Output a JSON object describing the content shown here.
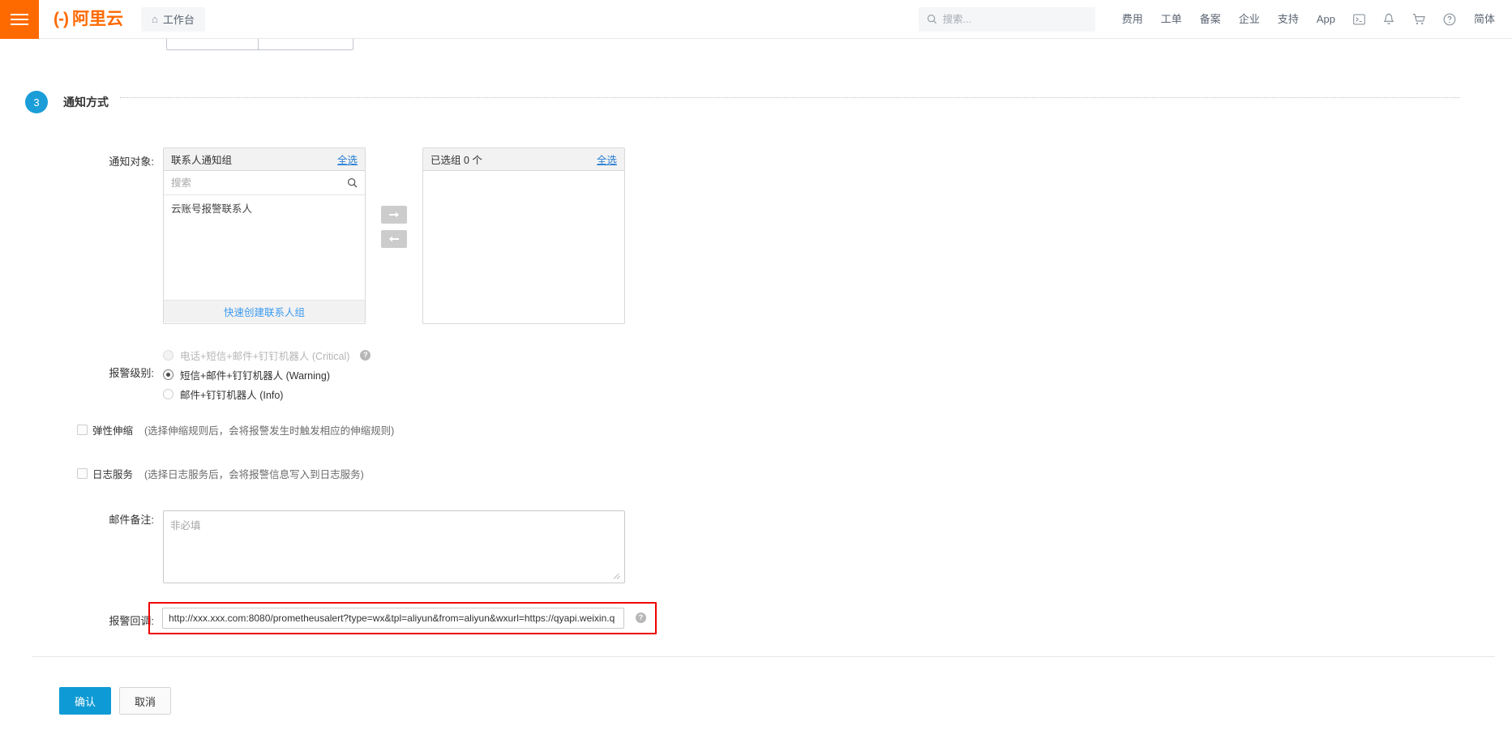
{
  "header": {
    "menu_icon": "hamburger-icon",
    "brand_mark": "(-)",
    "brand_name": "阿里云",
    "workbench_icon": "home-icon",
    "workbench_label": "工作台",
    "search": {
      "placeholder": "搜索...",
      "value": "",
      "icon": "search-icon"
    },
    "nav_links": [
      {
        "label": "费用"
      },
      {
        "label": "工单"
      },
      {
        "label": "备案"
      },
      {
        "label": "企业"
      },
      {
        "label": "支持"
      },
      {
        "label": "App"
      }
    ],
    "nav_icons": [
      {
        "name": "terminal-icon",
        "glyph": "▣"
      },
      {
        "name": "bell-icon",
        "glyph": "🔔"
      },
      {
        "name": "cart-icon",
        "glyph": "🛒"
      },
      {
        "name": "help-circle-icon",
        "glyph": "?"
      }
    ],
    "language_label": "简体"
  },
  "step": {
    "number": "3",
    "title": "通知方式",
    "accent_color": "#1b9ed8"
  },
  "form": {
    "notify_target": {
      "label": "通知对象:",
      "left_panel": {
        "title": "联系人通知组",
        "select_all_label": "全选",
        "search_placeholder": "搜索",
        "search_value": "",
        "search_icon": "search-icon",
        "items": [
          {
            "label": "云账号报警联系人"
          }
        ],
        "footer_link": "快速创建联系人组"
      },
      "transfer_to_right_icon": "arrow-right-icon",
      "transfer_to_left_icon": "arrow-left-icon",
      "transfer_to_right_glyph": "➜",
      "transfer_to_left_glyph": "➜",
      "right_panel": {
        "title": "已选组 0 个",
        "select_all_label": "全选",
        "items": []
      }
    },
    "alarm_level": {
      "label": "报警级别:",
      "options": [
        {
          "label": "电话+短信+邮件+钉钉机器人 (Critical)",
          "checked": false,
          "disabled": true,
          "has_help": true,
          "help_glyph": "?"
        },
        {
          "label": "短信+邮件+钉钉机器人 (Warning)",
          "checked": true,
          "disabled": false,
          "has_help": false
        },
        {
          "label": "邮件+钉钉机器人 (Info)",
          "checked": false,
          "disabled": false,
          "has_help": false
        }
      ]
    },
    "elastic_scaling": {
      "label": "弹性伸缩",
      "hint": "(选择伸缩规则后，会将报警发生时触发相应的伸缩规则)",
      "checked": false
    },
    "log_service": {
      "label": "日志服务",
      "hint": "(选择日志服务后，会将报警信息写入到日志服务)",
      "checked": false
    },
    "mail_remark": {
      "label": "邮件备注:",
      "placeholder": "非必填",
      "value": ""
    },
    "alarm_callback": {
      "label": "报警回调:",
      "value": "http://xxx.xxx.com:8080/prometheusalert?type=wx&tpl=aliyun&from=aliyun&wxurl=https://qyapi.weixin.q",
      "help_glyph": "?",
      "highlight_color": "#ee0000"
    }
  },
  "footer": {
    "confirm_label": "确认",
    "cancel_label": "取消",
    "primary_color": "#0e9ad4"
  }
}
